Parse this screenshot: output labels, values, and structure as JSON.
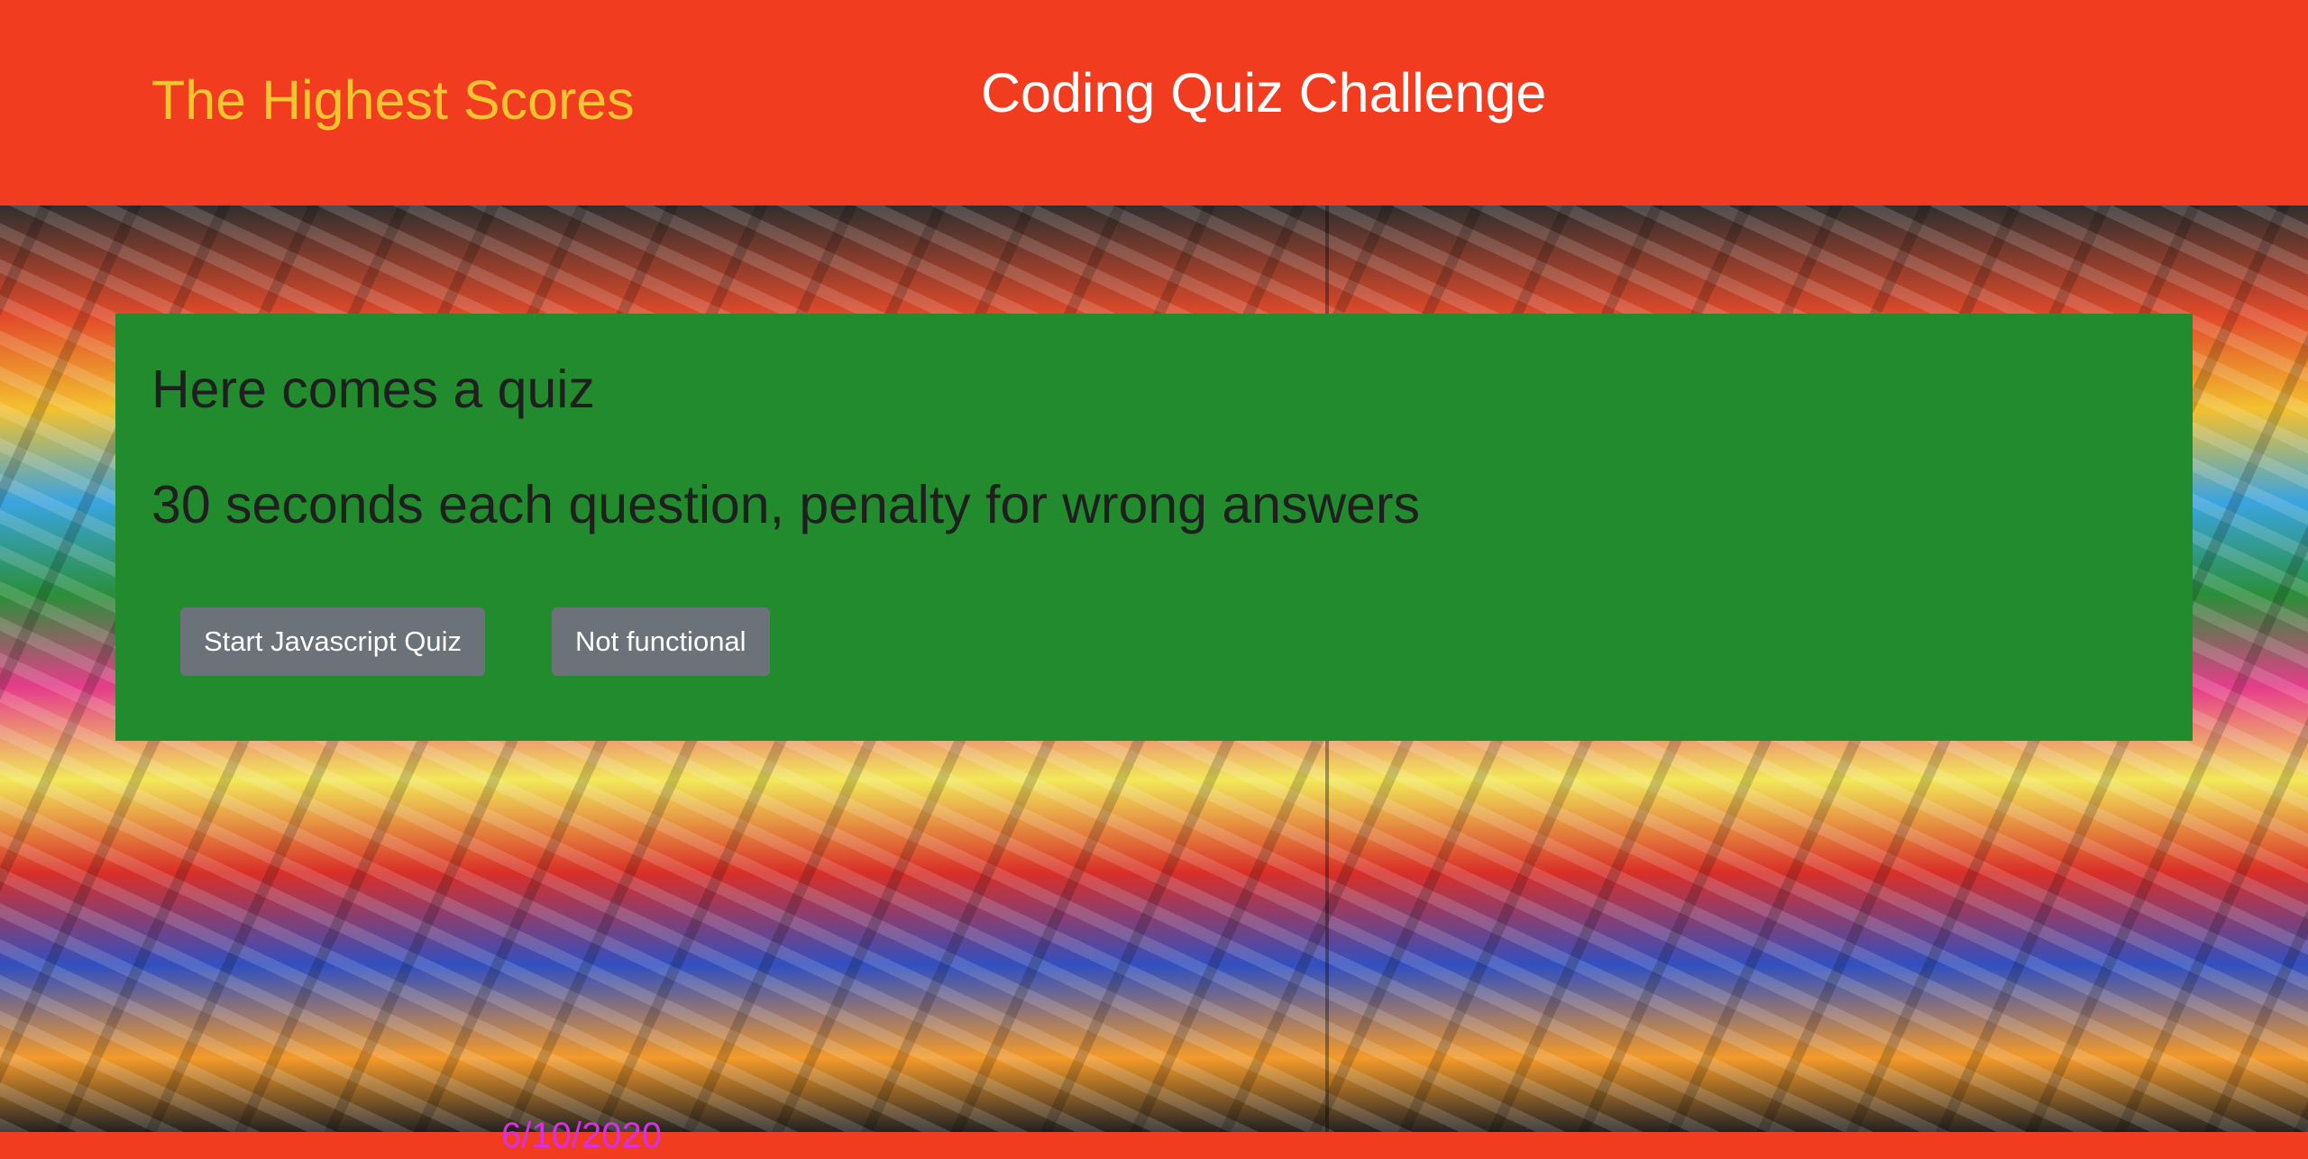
{
  "header": {
    "scores_link": "The Highest Scores",
    "title": "Coding Quiz Challenge"
  },
  "intro_card": {
    "heading": "Here comes a quiz",
    "description": "30 seconds each question, penalty for wrong answers",
    "start_button": "Start Javascript Quiz",
    "second_button": "Not functional"
  },
  "footer": {
    "date": "6/10/2020"
  },
  "colors": {
    "header_bg": "#f13c20",
    "link": "#f5c531",
    "card_bg": "#228b2e",
    "button_bg": "#6c727a",
    "date_text": "#d92fe0"
  }
}
